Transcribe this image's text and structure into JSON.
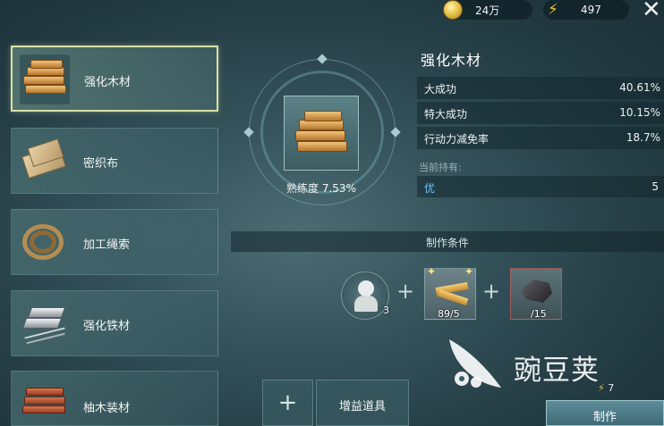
{
  "header": {
    "coins": "24万",
    "energy": "497",
    "coin_icon": "gold-coin-icon",
    "energy_icon": "lightning-bolt-icon",
    "close_icon": "close-icon"
  },
  "materials": [
    {
      "label": "强化木材",
      "icon": "reinforced-wood-icon",
      "selected": true
    },
    {
      "label": "密织布",
      "icon": "dense-cloth-icon",
      "selected": false
    },
    {
      "label": "加工绳索",
      "icon": "rope-coil-icon",
      "selected": false
    },
    {
      "label": "强化铁材",
      "icon": "iron-ingot-icon",
      "selected": false
    },
    {
      "label": "柚木装材",
      "icon": "teak-board-icon",
      "selected": false
    }
  ],
  "detail": {
    "title": "强化木材",
    "proficiency": "熟练度 7.53%",
    "proficiency_value": 7.53,
    "stats": [
      {
        "label": "大成功",
        "value": "40.61%"
      },
      {
        "label": "特大成功",
        "value": "10.15%"
      },
      {
        "label": "行动力减免率",
        "value": "18.7%"
      }
    ],
    "holding_label": "当前持有:",
    "holding": {
      "grade": "优",
      "count": "5"
    }
  },
  "crafting": {
    "section_title": "制作条件",
    "requirements": [
      {
        "icon": "character-portrait-icon",
        "count": "3"
      },
      {
        "icon": "wood-planks-icon",
        "count": "89/5"
      },
      {
        "icon": "ore-chunk-icon",
        "count": "/15"
      }
    ]
  },
  "actions": {
    "add_symbol": "+",
    "boost_label": "增益道具",
    "make_label": "制作",
    "energy_cost": "7"
  },
  "watermark": {
    "text": "豌豆荚",
    "icon": "pea-pod-logo-icon"
  },
  "colors": {
    "selected_border": "#d9e2a6",
    "energy_yellow": "#f2c12e",
    "holding_grade": "#6cc8ff"
  }
}
